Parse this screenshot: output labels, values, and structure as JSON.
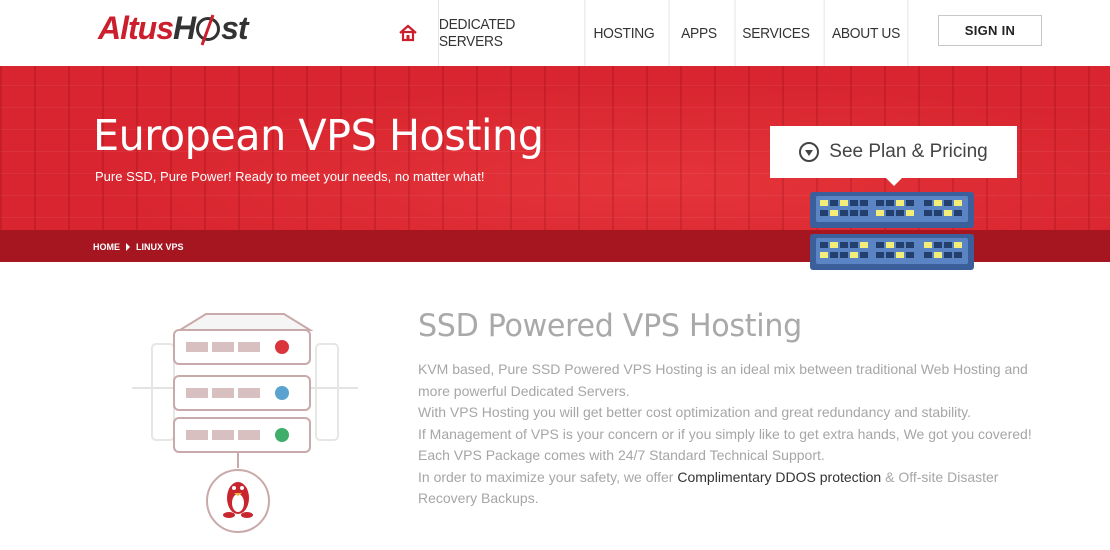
{
  "header": {
    "logo": {
      "part1": "Altus",
      "part2": "H",
      "part3": "st"
    },
    "nav": [
      {
        "label": "DEDICATED SERVERS"
      },
      {
        "label": "HOSTING"
      },
      {
        "label": "APPS"
      },
      {
        "label": "SERVICES"
      },
      {
        "label": "ABOUT US"
      }
    ],
    "signin": "SIGN IN"
  },
  "hero": {
    "title": "European VPS Hosting",
    "subtitle": "Pure SSD, Pure Power! Ready to meet your needs, no matter what!",
    "breadcrumb": {
      "home": "HOME",
      "current": "LINUX VPS"
    },
    "plan_button": "See Plan & Pricing"
  },
  "content": {
    "title": "SSD Powered VPS Hosting",
    "para1": "KVM based, Pure SSD Powered VPS Hosting is an ideal mix between traditional Web Hosting and more powerful Dedicated Servers.",
    "para2": "With VPS Hosting you will get better cost optimization and great redundancy and stability.",
    "para3": "If Management of VPS is your concern or if you simply like to get extra hands, We got you covered! Each VPS Package comes with 24/7 Standard Technical Support.",
    "para4_before": "In order to maximize your safety, we offer ",
    "para4_link": "Complimentary DDOS protection",
    "para4_after": " & Off-site Disaster Recovery Backups."
  },
  "colors": {
    "brand_red": "#d8252f",
    "dark_red": "#a51621",
    "led_red": "#d9353b",
    "led_blue": "#5aa2cf",
    "led_green": "#3fae6a"
  },
  "icons": [
    "home-icon",
    "play-down-icon",
    "linux-tux-icon",
    "server-stack-icon",
    "vps-server-icon"
  ]
}
